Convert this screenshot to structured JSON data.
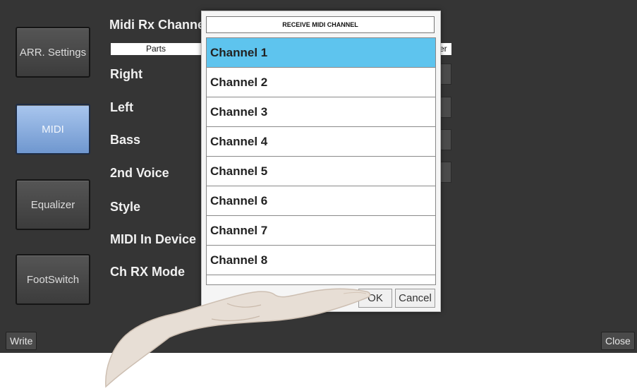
{
  "sidebar": {
    "items": [
      {
        "label": "ARR. Settings",
        "active": false
      },
      {
        "label": "MIDI",
        "active": true
      },
      {
        "label": "Equalizer",
        "active": false
      },
      {
        "label": "FootSwitch",
        "active": false
      }
    ]
  },
  "page": {
    "title": "Midi Rx Channel",
    "parts_header": "Parts",
    "right_header": "er",
    "rows": [
      "Right",
      "Left",
      "Bass",
      "2nd Voice",
      "Style",
      "MIDI In Device",
      "Ch RX Mode"
    ]
  },
  "bottom": {
    "write_label": "Write",
    "close_label": "Close"
  },
  "dialog": {
    "title": "RECEIVE MIDI CHANNEL",
    "channels": [
      "Channel 1",
      "Channel 2",
      "Channel 3",
      "Channel 4",
      "Channel 5",
      "Channel 6",
      "Channel 7",
      "Channel 8"
    ],
    "selected_index": 0,
    "ok_label": "OK",
    "cancel_label": "Cancel"
  },
  "colors": {
    "background": "#353535",
    "selected_channel": "#5ec4ee",
    "active_sidebar": "#8fb0e0"
  }
}
